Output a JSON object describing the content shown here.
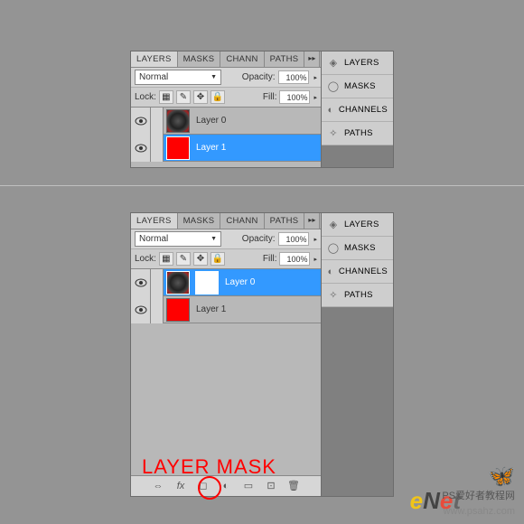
{
  "tabs": {
    "layers": "LAYERS",
    "masks": "MASKS",
    "channels": "CHANN",
    "paths": "PATHS",
    "arrows": "▸▸"
  },
  "controls": {
    "blend_mode": "Normal",
    "opacity_label": "Opacity:",
    "opacity_value": "100%",
    "lock_label": "Lock:",
    "fill_label": "Fill:",
    "fill_value": "100%"
  },
  "panel1": {
    "layers": [
      {
        "name": "Layer 0",
        "selected": false,
        "thumbs": [
          "dark"
        ]
      },
      {
        "name": "Layer 1",
        "selected": true,
        "thumbs": [
          "red"
        ]
      }
    ]
  },
  "panel2": {
    "layers": [
      {
        "name": "Layer 0",
        "selected": true,
        "thumbs": [
          "dark",
          "white"
        ]
      },
      {
        "name": "Layer 1",
        "selected": false,
        "thumbs": [
          "red"
        ]
      }
    ]
  },
  "side": {
    "layers": "LAYERS",
    "masks": "MASKS",
    "channels": "CHANNELS",
    "paths": "PATHS"
  },
  "annotation": "LAYER MASK",
  "watermark": {
    "line1": "PS爱好者教程网",
    "line2": "www.psahz.com"
  }
}
